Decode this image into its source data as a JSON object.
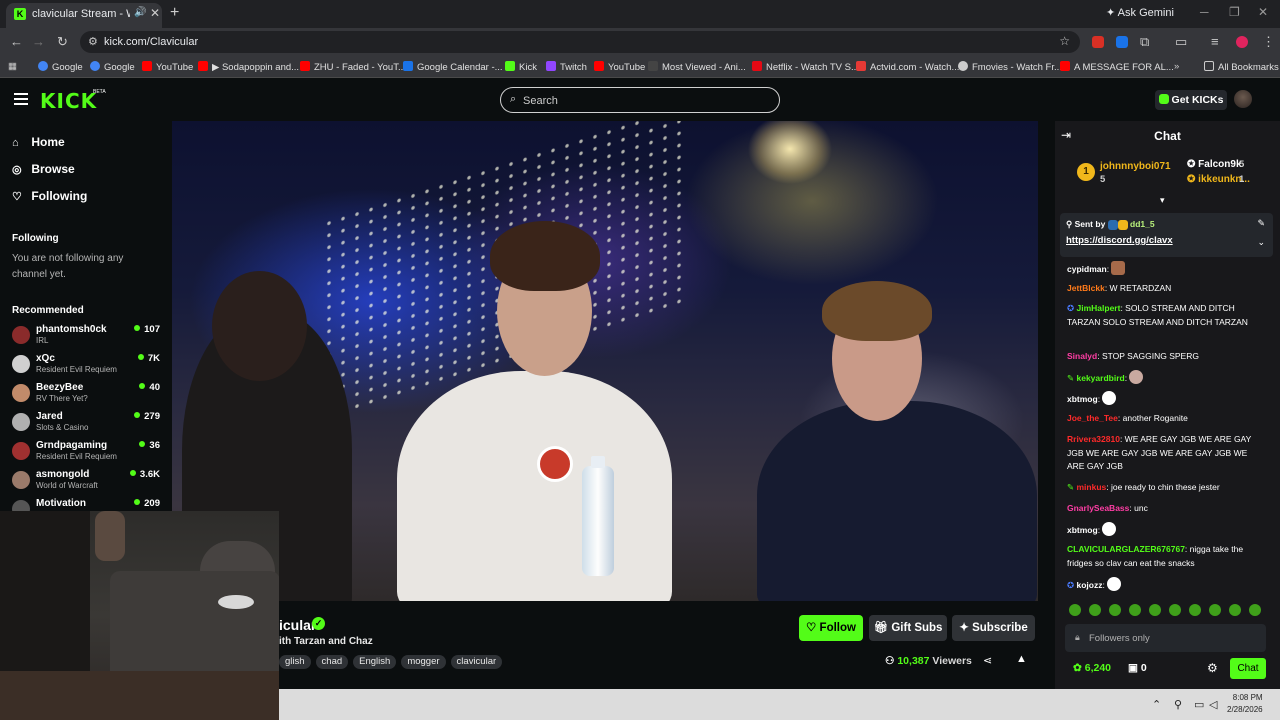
{
  "browser": {
    "tab_title": "clavicular Stream - Watch Li",
    "tab_favicon": "K",
    "ask_gemini": "Ask Gemini",
    "url": "kick.com/Clavicular",
    "bookmarks": [
      {
        "label": "Google",
        "color": "#4285f4"
      },
      {
        "label": "Google",
        "color": "#4285f4"
      },
      {
        "label": "YouTube",
        "color": "#ff0000"
      },
      {
        "label": "▶ Sodapoppin and...",
        "color": "#ff0000"
      },
      {
        "label": "ZHU - Faded - YouT...",
        "color": "#ff0000"
      },
      {
        "label": "Google Calendar -...",
        "color": "#1a73e8"
      },
      {
        "label": "Kick",
        "color": "#53fc18"
      },
      {
        "label": "Twitch",
        "color": "#9146ff"
      },
      {
        "label": "YouTube",
        "color": "#ff0000"
      },
      {
        "label": "Most Viewed - Ani...",
        "color": "#444444"
      },
      {
        "label": "Netflix - Watch TV S...",
        "color": "#e50914"
      },
      {
        "label": "Actvid.com - Watch...",
        "color": "#e53935"
      },
      {
        "label": "Fmovies - Watch Fr...",
        "color": "#cccccc"
      },
      {
        "label": "A MESSAGE FOR AL...",
        "color": "#ff0000"
      }
    ],
    "all_bookmarks": "All Bookmarks"
  },
  "header": {
    "logo": "KICK",
    "beta": "BETA",
    "search_placeholder": "Search",
    "get_kicks": "Get KICKs"
  },
  "sidebar": {
    "nav": [
      {
        "label": "Home",
        "icon": "home-icon"
      },
      {
        "label": "Browse",
        "icon": "compass-icon"
      },
      {
        "label": "Following",
        "icon": "heart-icon"
      }
    ],
    "following_title": "Following",
    "following_empty": "You are not following any channel yet.",
    "recommended_title": "Recommended",
    "recommended": [
      {
        "name": "phantomsh0ck",
        "category": "IRL",
        "viewers": "107",
        "avatar": "#8a2b2b"
      },
      {
        "name": "xQc",
        "category": "Resident Evil Requiem",
        "viewers": "7K",
        "avatar": "#d0d0d0"
      },
      {
        "name": "BeezyBee",
        "category": "RV There Yet?",
        "viewers": "40",
        "avatar": "#c28b6a"
      },
      {
        "name": "Jared",
        "category": "Slots & Casino",
        "viewers": "279",
        "avatar": "#b0b0b0"
      },
      {
        "name": "Grndpagaming",
        "category": "Resident Evil Requiem",
        "viewers": "36",
        "avatar": "#a03030"
      },
      {
        "name": "asmongold",
        "category": "World of Warcraft",
        "viewers": "3.6K",
        "avatar": "#9a7a6a"
      },
      {
        "name": "Motivation",
        "category": "",
        "viewers": "209",
        "avatar": "#555555"
      }
    ]
  },
  "stream": {
    "name": "icular",
    "title": "ith Tarzan and Chaz",
    "tags": [
      "glish",
      "chad",
      "English",
      "mogger",
      "clavicular"
    ],
    "follow": "Follow",
    "gift_subs": "Gift Subs",
    "subscribe": "Subscribe",
    "viewers_count": "10,387",
    "viewers_label": "Viewers"
  },
  "chat": {
    "title": "Chat",
    "leaderboard": [
      {
        "rank": "1",
        "name": "johnnnyboi071",
        "value": "5",
        "color": "#f0b71b"
      },
      {
        "name": "Falcon9k",
        "value": "5",
        "color": "#ffffff"
      },
      {
        "name": "ikkeunkn...",
        "value": "1",
        "color": "#f0b71b"
      }
    ],
    "pinned": {
      "sent_by": "Sent by",
      "user": "dd1_5",
      "link": "https://discord.gg/clavx"
    },
    "messages": [
      {
        "user": "cypidman",
        "color": "#ffffff",
        "text": ""
      },
      {
        "user": "JettBlckk",
        "color": "#ff7a1a",
        "text": "W RETARDZAN"
      },
      {
        "user": "JimHalpert",
        "color": "#53fc18",
        "text": "SOLO STREAM AND DITCH TARZAN      SOLO STREAM AND DITCH TARZAN"
      },
      {
        "user": "Sinalyd",
        "color": "#ff3ea5",
        "text": "STOP SAGGING SPERG"
      },
      {
        "user": "kekyardbird",
        "color": "#53fc18",
        "text": ""
      },
      {
        "user": "xbtmog",
        "color": "#ffffff",
        "text": ""
      },
      {
        "user": "Joe_the_Tee",
        "color": "#ff2a2a",
        "text": "another Roganite"
      },
      {
        "user": "Rrivera32810",
        "color": "#ff2a2a",
        "text": "WE ARE GAY JGB WE ARE GAY JGB WE ARE GAY JGB WE ARE GAY JGB WE ARE GAY JGB"
      },
      {
        "user": "minkus",
        "color": "#ff2a2a",
        "text": "joe ready to chin these jester"
      },
      {
        "user": "GnarlySeaBass",
        "color": "#ff3ea5",
        "text": "unc"
      },
      {
        "user": "xbtmog",
        "color": "#ffffff",
        "text": ""
      },
      {
        "user": "CLAVICULARGLAZER676767",
        "color": "#53fc18",
        "text": "nigga take the fridges so clav can eat the snacks"
      },
      {
        "user": "kojozz",
        "color": "#ffffff",
        "text": ""
      }
    ],
    "input_placeholder": "Followers only",
    "kicks_points": "6,240",
    "gift_count": "0",
    "chat_button": "Chat"
  },
  "taskbar": {
    "time": "8:08 PM",
    "date": "2/28/2026"
  }
}
